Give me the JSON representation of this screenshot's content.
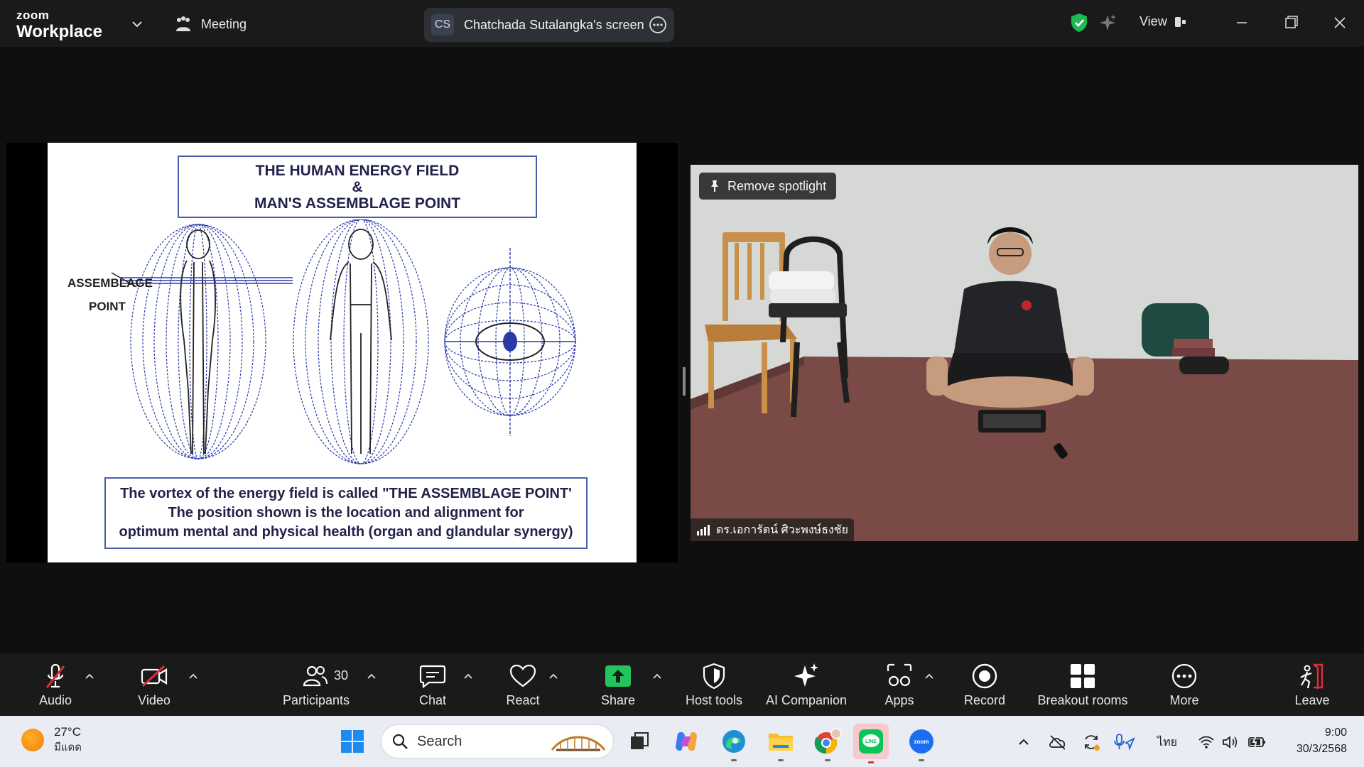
{
  "titlebar": {
    "brand_small": "zoom",
    "brand_large": "Workplace",
    "meeting_label": "Meeting",
    "share_initials": "CS",
    "share_label": "Chatchada Sutalangka's screen",
    "view_label": "View"
  },
  "slide": {
    "title_line1": "THE  HUMAN ENERGY  FIELD",
    "title_line2": "&",
    "title_line3": "MAN'S ASSEMBLAGE POINT",
    "label_line1": "ASSEMBLAGE",
    "label_line2": "POINT",
    "caption_line1": "The vortex of the energy field is called \"THE ASSEMBLAGE POINT'",
    "caption_line2": "The position shown is the location and alignment for",
    "caption_line3": "optimum mental and physical health (organ and glandular synergy)"
  },
  "video": {
    "spotlight_label": "Remove spotlight",
    "participant_name": "ดร.เอการัตน์ ศิวะพงษ์ธงชัย"
  },
  "toolbar": {
    "audio": "Audio",
    "video": "Video",
    "participants": "Participants",
    "participants_count": "30",
    "chat": "Chat",
    "react": "React",
    "share": "Share",
    "host_tools": "Host tools",
    "ai_companion": "AI Companion",
    "apps": "Apps",
    "record": "Record",
    "breakout_rooms": "Breakout rooms",
    "more": "More",
    "leave": "Leave"
  },
  "taskbar": {
    "temperature": "27°C",
    "weather_text": "มีแดด",
    "search_placeholder": "Search",
    "language": "ไทย",
    "time": "9:00",
    "date": "30/3/2568"
  },
  "colors": {
    "share_green": "#22c55e",
    "mute_red": "#e02d3c",
    "leave_red": "#e02d3c",
    "shield_green": "#1db954"
  }
}
